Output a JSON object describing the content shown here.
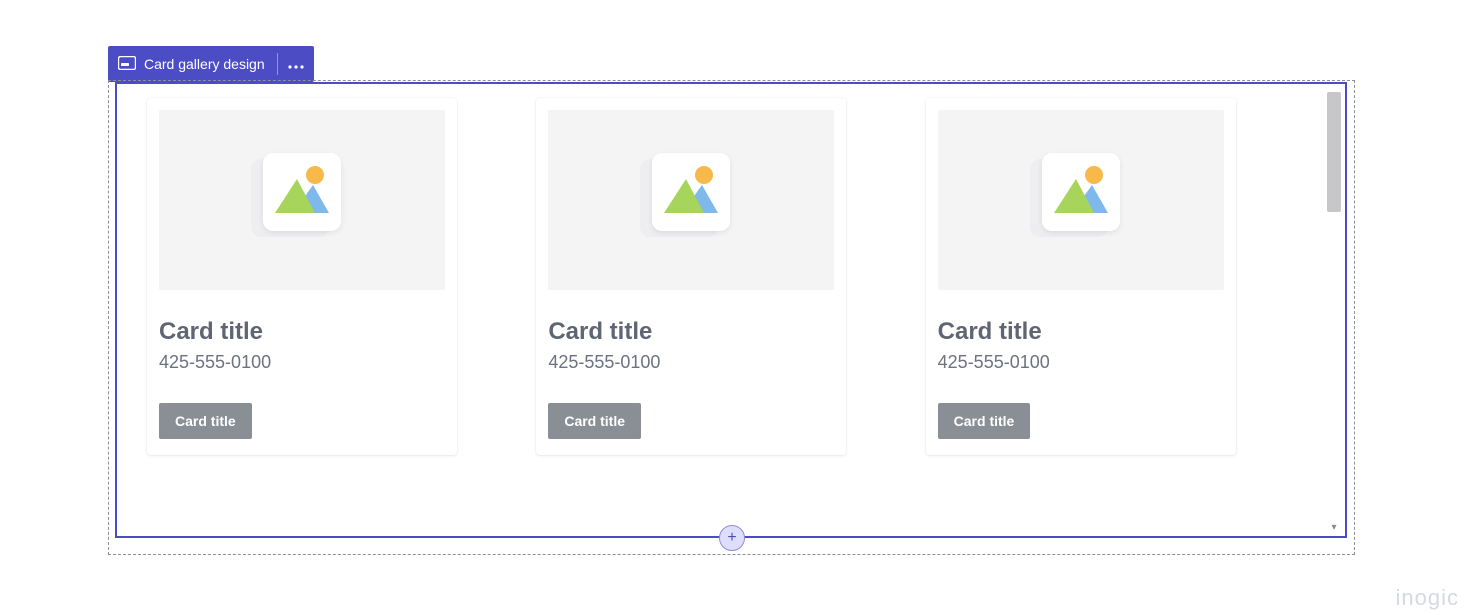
{
  "selection": {
    "label": "Card gallery design"
  },
  "cards": [
    {
      "title": "Card title",
      "subtitle": "425-555-0100",
      "button": "Card title"
    },
    {
      "title": "Card title",
      "subtitle": "425-555-0100",
      "button": "Card title"
    },
    {
      "title": "Card title",
      "subtitle": "425-555-0100",
      "button": "Card title"
    }
  ],
  "watermark": "inogic"
}
